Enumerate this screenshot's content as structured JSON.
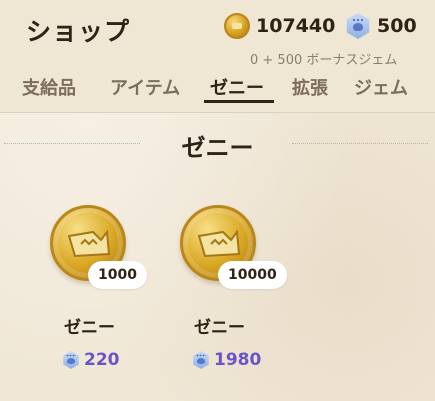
{
  "header": {
    "title": "ショップ",
    "zeny_amount": "107440",
    "gem_amount": "500",
    "bonus_text": "0 + 500 ボーナスジェム"
  },
  "tabs": [
    {
      "label": "支給品"
    },
    {
      "label": "アイテム"
    },
    {
      "label": "ゼニー",
      "active": true
    },
    {
      "label": "拡張"
    },
    {
      "label": "ジェム"
    }
  ],
  "section": {
    "title": "ゼニー"
  },
  "items": [
    {
      "amount": "1000",
      "name": "ゼニー",
      "price": "220",
      "icon": "zeny-coin-icon"
    },
    {
      "amount": "10000",
      "name": "ゼニー",
      "price": "1980",
      "icon": "zeny-coin-icon"
    }
  ],
  "colors": {
    "background": "#f0e7d6",
    "text_dark": "#2f2217",
    "tab_inactive": "#7c6d5d",
    "price_purple": "#6a55c8",
    "coin_gold": "#d8a622"
  }
}
